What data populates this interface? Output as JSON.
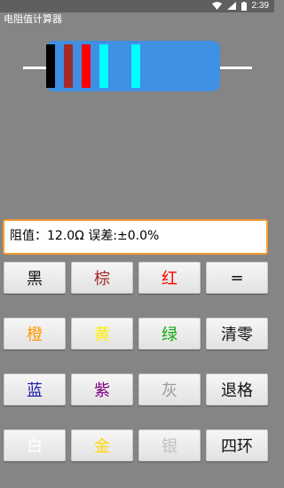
{
  "status_bar": {
    "time": "2:39"
  },
  "app": {
    "title": "电阻值计算器"
  },
  "resistor": {
    "body_color": "#3f8fe3",
    "lead_color": "#ffffff",
    "bands": [
      "#000000",
      "#a52a2a",
      "#ff0000",
      "#00ffff",
      "#00ffff"
    ]
  },
  "display": {
    "text": "阻值：12.0Ω 误差:±0.0%"
  },
  "keypad": [
    {
      "label": "黑",
      "color": "#111111"
    },
    {
      "label": "棕",
      "color": "#a52a2a"
    },
    {
      "label": "红",
      "color": "#ff0000"
    },
    {
      "label": "=",
      "color": "#111111"
    },
    {
      "label": "橙",
      "color": "#ff9900"
    },
    {
      "label": "黄",
      "color": "#ffee00"
    },
    {
      "label": "绿",
      "color": "#11aa11"
    },
    {
      "label": "清零",
      "color": "#111111"
    },
    {
      "label": "蓝",
      "color": "#1a1aaa"
    },
    {
      "label": "紫",
      "color": "#800080"
    },
    {
      "label": "灰",
      "color": "#9a9a9a"
    },
    {
      "label": "退格",
      "color": "#111111"
    },
    {
      "label": "白",
      "color": "#ffffff"
    },
    {
      "label": "金",
      "color": "#ffd700"
    },
    {
      "label": "银",
      "color": "#c0c0c0"
    },
    {
      "label": "四环",
      "color": "#111111"
    }
  ]
}
